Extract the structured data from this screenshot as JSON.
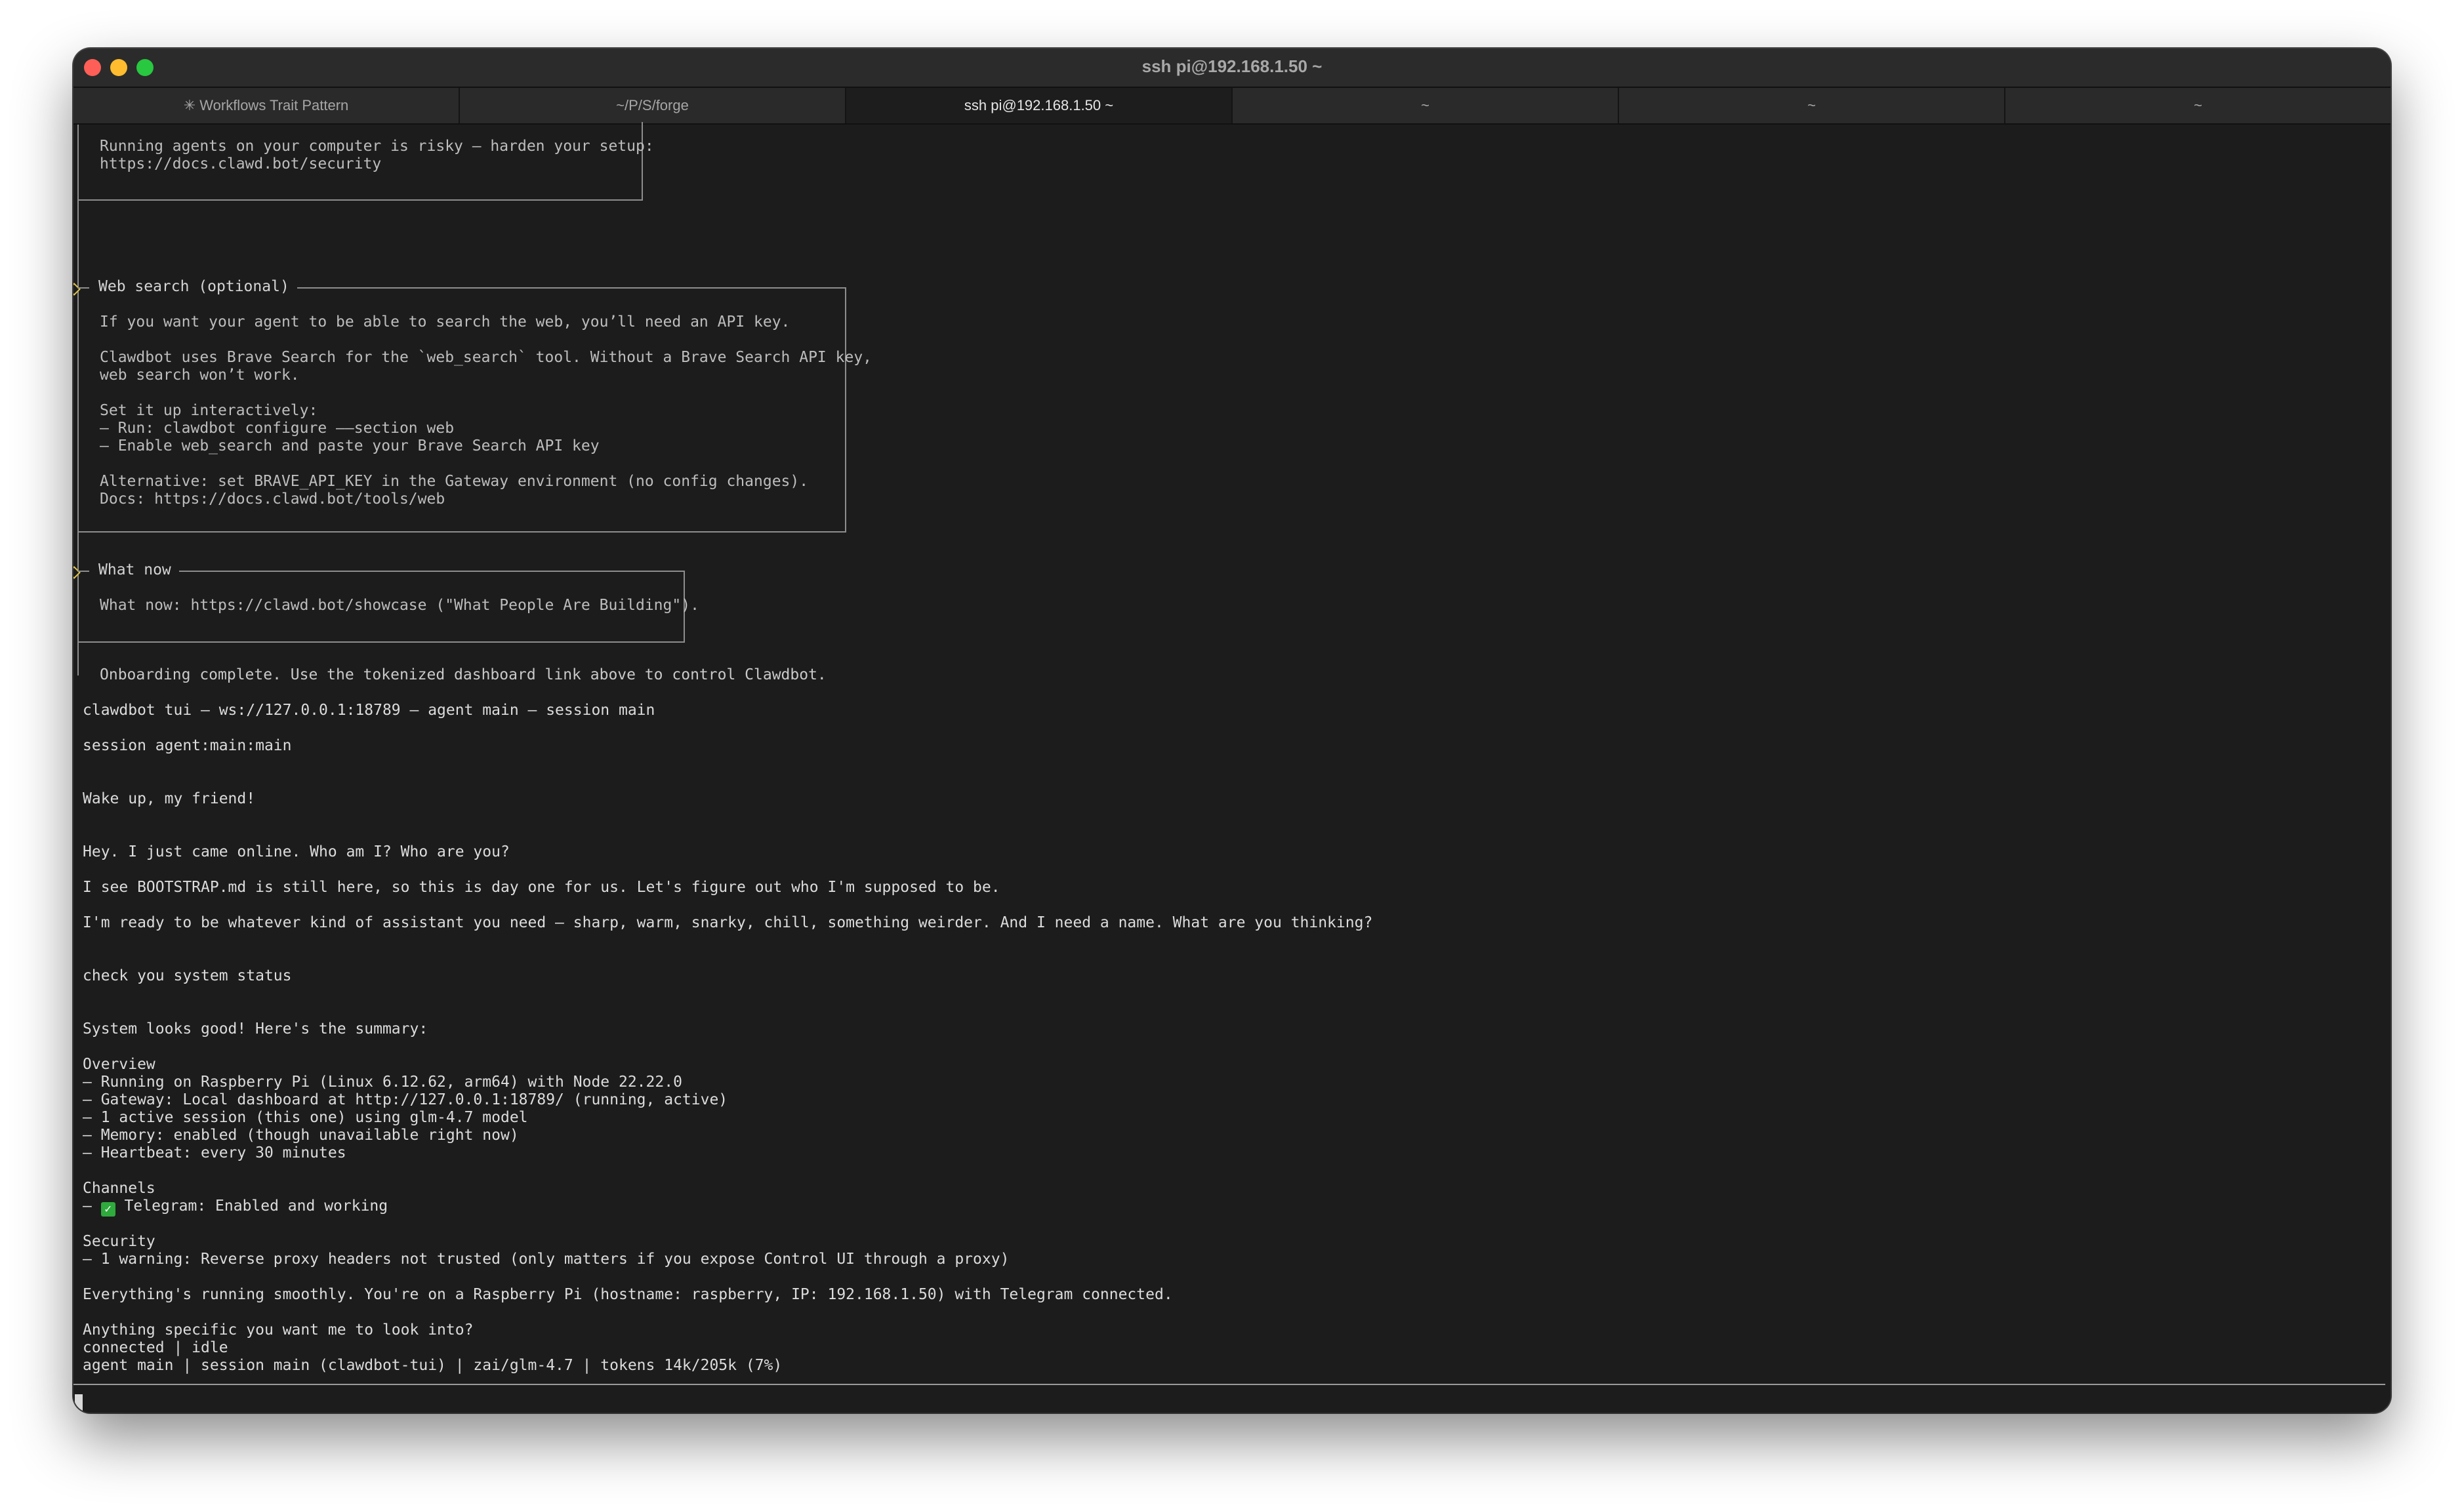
{
  "window": {
    "title": "ssh pi@192.168.1.50 ~"
  },
  "tabs": [
    {
      "label": "✳ Workflows Trait Pattern",
      "active": false
    },
    {
      "label": "~/P/S/forge",
      "active": false
    },
    {
      "label": "ssh pi@192.168.1.50 ~",
      "active": true
    },
    {
      "label": "~",
      "active": false
    },
    {
      "label": "~",
      "active": false
    },
    {
      "label": "~",
      "active": false
    }
  ],
  "security_box": {
    "lines": [
      "Running agents on your computer is risky — harden your setup:",
      "https://docs.clawd.bot/security"
    ]
  },
  "web_search_box": {
    "title": "Web search (optional)",
    "lines": [
      "If you want your agent to be able to search the web, you’ll need an API key.",
      "",
      "Clawdbot uses Brave Search for the `web_search` tool. Without a Brave Search API key,",
      "web search won’t work.",
      "",
      "Set it up interactively:",
      "– Run: clawdbot configure ——section web",
      "– Enable web_search and paste your Brave Search API key",
      "",
      "Alternative: set BRAVE_API_KEY in the Gateway environment (no config changes).",
      "Docs: https://docs.clawd.bot/tools/web"
    ]
  },
  "what_now_box": {
    "title": "What now",
    "lines": [
      "What now: https://clawd.bot/showcase (\"What People Are Building\")."
    ]
  },
  "onboarding": "Onboarding complete. Use the tokenized dashboard link above to control Clawdbot.",
  "terminal": {
    "tui_header": "clawdbot tui – ws://127.0.0.1:18789 – agent main – session main",
    "session": "session agent:main:main",
    "user_msg_1": "Wake up, my friend!",
    "bot_reply_1": [
      "Hey. I just came online. Who am I? Who are you?",
      "I see BOOTSTRAP.md is still here, so this is day one for us. Let's figure out who I'm supposed to be.",
      "I'm ready to be whatever kind of assistant you need — sharp, warm, snarky, chill, something weirder. And I need a name. What are you thinking?"
    ],
    "user_msg_2": "check you system status",
    "summary_intro": "System looks good! Here's the summary:",
    "overview_heading": "Overview",
    "overview_items": [
      "– Running on Raspberry Pi (Linux 6.12.62, arm64) with Node 22.22.0",
      "– Gateway: Local dashboard at http://127.0.0.1:18789/ (running, active)",
      "– 1 active session (this one) using glm-4.7 model",
      "– Memory: enabled (though unavailable right now)",
      "– Heartbeat: every 30 minutes"
    ],
    "channels_heading": "Channels",
    "channels_prefix": "– ",
    "channels_check": "✓",
    "channels_item": " Telegram: Enabled and working",
    "security_heading": "Security",
    "security_item": "– 1 warning: Reverse proxy headers not trusted (only matters if you expose Control UI through a proxy)",
    "everything_line": "Everything's running smoothly. You're on a Raspberry Pi (hostname: raspberry, IP: 192.168.1.50) with Telegram connected.",
    "question_line": "Anything specific you want me to look into?",
    "status_line": "connected | idle",
    "footer_line": "agent main | session main (clawdbot-tui) | zai/glm-4.7 | tokens 14k/205k (7%)"
  }
}
